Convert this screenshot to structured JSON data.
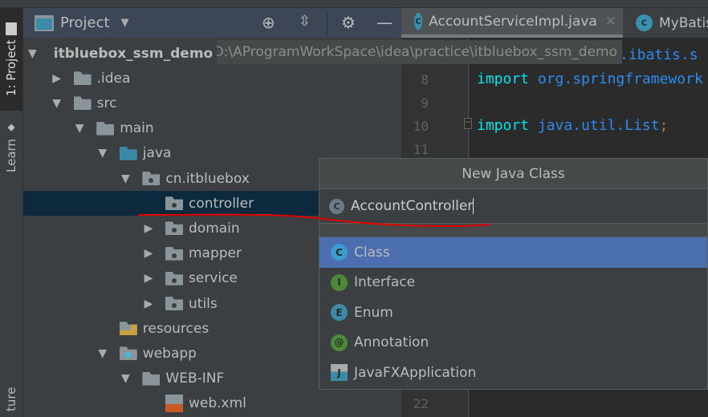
{
  "left_stripe": {
    "project_tab": "1: Project",
    "learn_tab": "Learn",
    "structure_tab": "ture"
  },
  "project_panel": {
    "title": "Project"
  },
  "tree": [
    {
      "label": "itbluebox_ssm_demo",
      "path": "D:\\AProgramWorkSpace\\idea\\practice\\itbluebox_ssm_demo",
      "level": 0,
      "expanded": true,
      "icon": "module-folder"
    },
    {
      "label": ".idea",
      "level": 1,
      "expanded": false,
      "icon": "folder"
    },
    {
      "label": "src",
      "level": 1,
      "expanded": true,
      "icon": "folder"
    },
    {
      "label": "main",
      "level": 2,
      "expanded": true,
      "icon": "folder"
    },
    {
      "label": "java",
      "level": 3,
      "expanded": true,
      "icon": "source-folder"
    },
    {
      "label": "cn.itbluebox",
      "level": 4,
      "expanded": true,
      "icon": "package"
    },
    {
      "label": "controller",
      "level": 5,
      "selected": true,
      "icon": "package"
    },
    {
      "label": "domain",
      "level": 5,
      "expanded": false,
      "icon": "package"
    },
    {
      "label": "mapper",
      "level": 5,
      "expanded": false,
      "icon": "package"
    },
    {
      "label": "service",
      "level": 5,
      "expanded": false,
      "icon": "package"
    },
    {
      "label": "utils",
      "level": 5,
      "expanded": false,
      "icon": "package"
    },
    {
      "label": "resources",
      "level": 3,
      "icon": "resources-folder"
    },
    {
      "label": "webapp",
      "level": 3,
      "expanded": true,
      "icon": "web-folder"
    },
    {
      "label": "WEB-INF",
      "level": 4,
      "expanded": true,
      "icon": "folder"
    },
    {
      "label": "web.xml",
      "level": 5,
      "icon": "xml-file"
    }
  ],
  "tabs": [
    {
      "label": "AccountServiceImpl.java",
      "active": true
    },
    {
      "label": "MyBatis"
    }
  ],
  "editor": {
    "tooltip_path": "D:\\AProgramWorkSpace\\idea\\practice\\itbluebox_ssm_demo",
    "line7_tail": ".ibatis.s",
    "lines": [
      {
        "num": "8",
        "kw": "import",
        "pkg": "org.springframework",
        "end": ""
      },
      {
        "num": "9",
        "kw": "",
        "pkg": "",
        "end": ""
      },
      {
        "num": "10",
        "kw": "import",
        "pkg": "java.util.List",
        "end": ";"
      },
      {
        "num": "11",
        "kw": "",
        "pkg": "",
        "end": ""
      },
      {
        "num": "22",
        "kw": "",
        "pkg": "",
        "end": ""
      }
    ]
  },
  "dialog": {
    "title": "New Java Class",
    "input_value": "AccountController",
    "kinds": [
      {
        "label": "Class",
        "letter": "C",
        "color": "#3b9ad0",
        "selected": true
      },
      {
        "label": "Interface",
        "letter": "I",
        "color": "#4c8a3a"
      },
      {
        "label": "Enum",
        "letter": "E",
        "color": "#3a8aa8"
      },
      {
        "label": "Annotation",
        "letter": "@",
        "color": "#4c8a3a"
      },
      {
        "label": "JavaFXApplication",
        "letter": "J",
        "color": "#3a8aa8"
      }
    ]
  },
  "colors": {
    "selection": "#0d293e",
    "list_selection": "#4b6eaf",
    "annotation": "#e00000"
  }
}
